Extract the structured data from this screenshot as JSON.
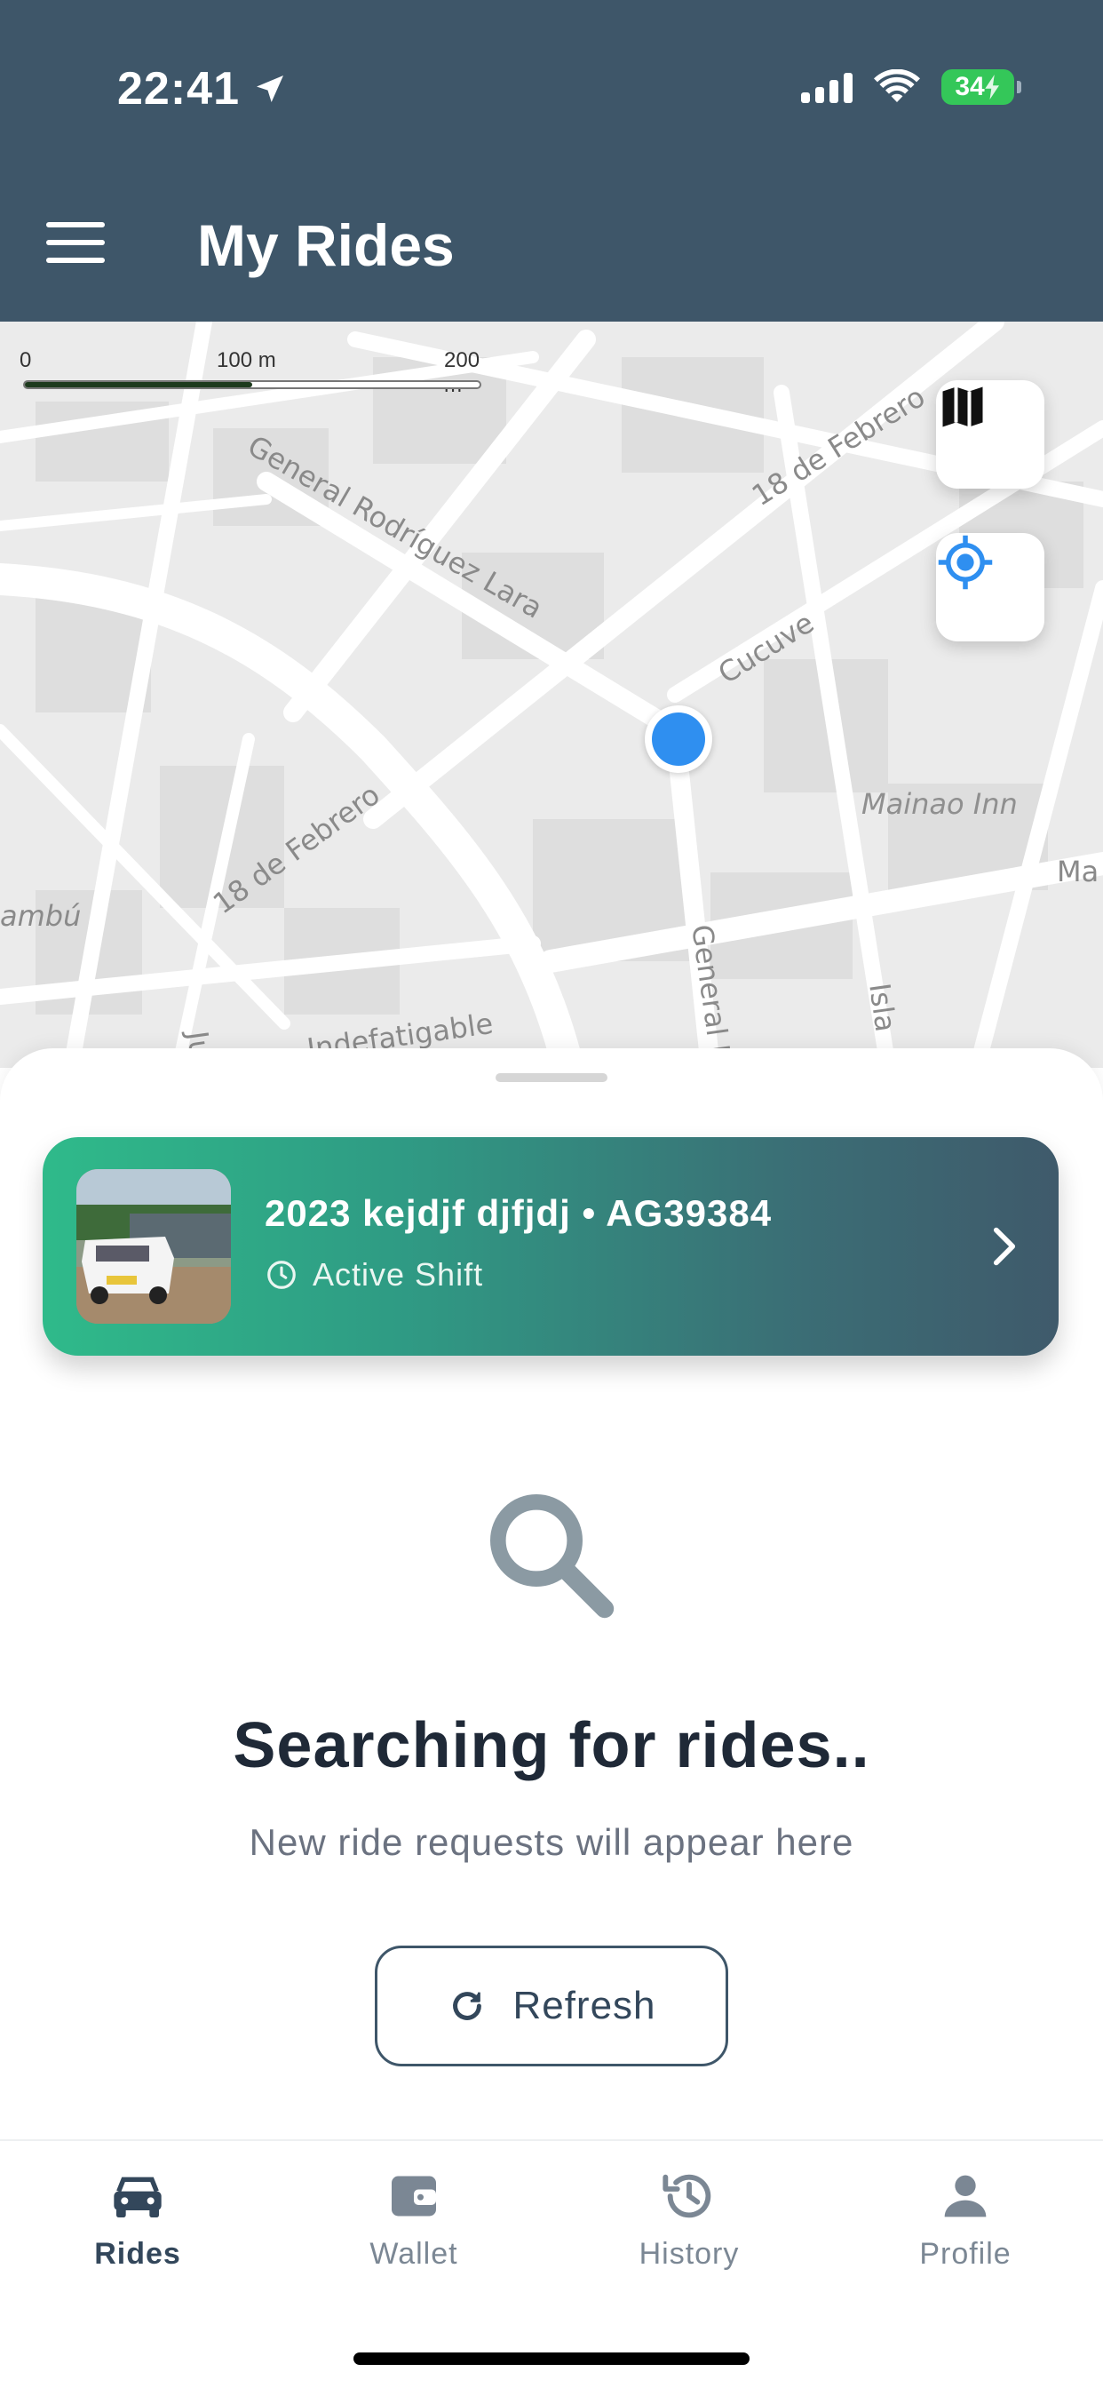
{
  "status_bar": {
    "time": "22:41",
    "battery": "34"
  },
  "header": {
    "title": "My Rides"
  },
  "map": {
    "scale_labels": [
      "0",
      "100 m",
      "200 m"
    ],
    "street_labels": [
      {
        "text": "General Rodríguez Lara"
      },
      {
        "text": "18 de Febrero"
      },
      {
        "text": "Cucuve"
      },
      {
        "text": "18 de Febrero"
      },
      {
        "text": "Mainao Inn"
      },
      {
        "text": "General R"
      },
      {
        "text": "Indefatigable"
      },
      {
        "text": "Isla"
      },
      {
        "text": "ambú"
      },
      {
        "text": "Ju"
      },
      {
        "text": "Ma"
      }
    ]
  },
  "vehicle_card": {
    "title": "2023 kejdjf djfjdj • AG39384",
    "status": "Active Shift"
  },
  "empty_state": {
    "title": "Searching for rides..",
    "subtitle": "New ride requests will appear here",
    "refresh_label": "Refresh"
  },
  "tabs": [
    {
      "label": "Rides",
      "icon": "car-icon",
      "active": true
    },
    {
      "label": "Wallet",
      "icon": "wallet-icon",
      "active": false
    },
    {
      "label": "History",
      "icon": "history-icon",
      "active": false
    },
    {
      "label": "Profile",
      "icon": "person-icon",
      "active": false
    }
  ],
  "colors": {
    "header": "#3e5669",
    "accent_blue": "#2f8ff0",
    "card_start": "#2fba8a",
    "card_end": "#3f5a6b"
  }
}
